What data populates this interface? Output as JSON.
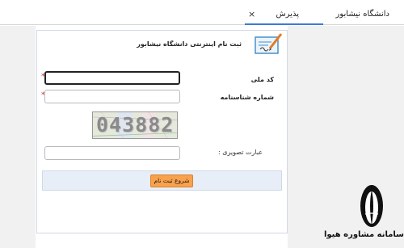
{
  "tabs": {
    "university_label": "دانشگاه نیشابور",
    "active_label": "پذیرش",
    "close_symbol": "×"
  },
  "form": {
    "title": "ثبت نام اینترنتی دانشگاه نیشابور",
    "national_code_label": "کد ملی",
    "id_card_label": "شماره شناسنامه",
    "captcha_label": "عبارت تصویری :",
    "required_mark": "*",
    "captcha_text": "043882",
    "submit_label": "شروع ثبت نام"
  },
  "brand": {
    "text": "سامانه مشاوره هیوا"
  },
  "icons": {
    "header": "form-signature-icon",
    "logo": "hiva-logo-icon",
    "close": "close-icon"
  },
  "colors": {
    "accent_tab": "#3a7bd5",
    "button": "#f9a14b",
    "required": "#d02020",
    "panel_border": "#d0d9e4",
    "submit_bar": "#e7eef8"
  }
}
